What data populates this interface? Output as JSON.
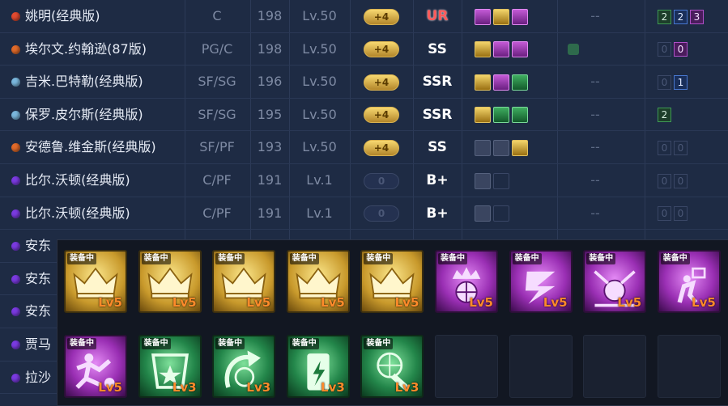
{
  "rows": [
    {
      "name": "姚明(经典版)",
      "dot": "#e04a30",
      "pos": "C",
      "height": "198",
      "level": "Lv.50",
      "plus": "+4",
      "plus_on": true,
      "rank": "UR",
      "skills": [
        "purple",
        "gold",
        "purple"
      ],
      "dash": "--",
      "badges": [
        {
          "t": "2",
          "c": "g"
        },
        {
          "t": "2",
          "c": "b"
        },
        {
          "t": "3",
          "c": "p"
        }
      ]
    },
    {
      "name": "埃尔文.约翰逊(87版)",
      "dot": "#e06a2a",
      "pos": "PG/C",
      "height": "198",
      "level": "Lv.50",
      "plus": "+4",
      "plus_on": true,
      "rank": "SS",
      "skills": [
        "gold",
        "purple",
        "purple"
      ],
      "extra": true,
      "dash": "",
      "badges": [
        {
          "t": "0",
          "c": ""
        },
        {
          "t": "0",
          "c": "p"
        }
      ]
    },
    {
      "name": "吉米.巴特勒(经典版)",
      "dot": "#7ab6dc",
      "pos": "SF/SG",
      "height": "196",
      "level": "Lv.50",
      "plus": "+4",
      "plus_on": true,
      "rank": "SSR",
      "skills": [
        "gold",
        "purple",
        "green"
      ],
      "dash": "--",
      "badges": [
        {
          "t": "0",
          "c": ""
        },
        {
          "t": "1",
          "c": "b"
        }
      ]
    },
    {
      "name": "保罗.皮尔斯(经典版)",
      "dot": "#7ab6dc",
      "pos": "SF/SG",
      "height": "195",
      "level": "Lv.50",
      "plus": "+4",
      "plus_on": true,
      "rank": "SSR",
      "skills": [
        "gold",
        "green",
        "green"
      ],
      "dash": "--",
      "badges": [
        {
          "t": "2",
          "c": "g"
        }
      ]
    },
    {
      "name": "安德鲁.维金斯(经典版)",
      "dot": "#e06a2a",
      "pos": "SF/PF",
      "height": "193",
      "level": "Lv.50",
      "plus": "+4",
      "plus_on": true,
      "rank": "SS",
      "skills": [
        "grey",
        "grey",
        "gold"
      ],
      "dash": "--",
      "badges": [
        {
          "t": "0",
          "c": ""
        },
        {
          "t": "0",
          "c": ""
        }
      ]
    },
    {
      "name": "比尔.沃顿(经典版)",
      "dot": "#7a3ae0",
      "pos": "C/PF",
      "height": "191",
      "level": "Lv.1",
      "plus": "0",
      "plus_on": false,
      "rank": "B+",
      "skills": [
        "lock",
        "empty"
      ],
      "dash": "--",
      "badges": [
        {
          "t": "0",
          "c": ""
        },
        {
          "t": "0",
          "c": ""
        }
      ]
    },
    {
      "name": "比尔.沃顿(经典版)",
      "dot": "#7a3ae0",
      "pos": "C/PF",
      "height": "191",
      "level": "Lv.1",
      "plus": "0",
      "plus_on": false,
      "rank": "B+",
      "skills": [
        "lock",
        "empty"
      ],
      "dash": "--",
      "badges": [
        {
          "t": "0",
          "c": ""
        },
        {
          "t": "0",
          "c": ""
        }
      ]
    },
    {
      "name": "安东",
      "dot": "#7a3ae0"
    },
    {
      "name": "安东",
      "dot": "#7a3ae0"
    },
    {
      "name": "安东",
      "dot": "#7a3ae0"
    },
    {
      "name": "贾马",
      "dot": "#7a3ae0"
    },
    {
      "name": "拉沙",
      "dot": "#7a3ae0"
    }
  ],
  "popup": {
    "equipped_tag": "装备中",
    "row1": [
      {
        "color": "gold",
        "glyph": "crown-icon",
        "level": "Lv5"
      },
      {
        "color": "gold",
        "glyph": "crown-icon",
        "level": "Lv5"
      },
      {
        "color": "gold",
        "glyph": "crown-icon",
        "level": "Lv5"
      },
      {
        "color": "gold",
        "glyph": "crown-icon",
        "level": "Lv5"
      },
      {
        "color": "gold",
        "glyph": "crown-icon",
        "level": "Lv5"
      },
      {
        "color": "purple",
        "glyph": "crown-ball-icon",
        "level": "Lv5"
      },
      {
        "color": "purple",
        "glyph": "play-arrow-icon",
        "level": "Lv5"
      },
      {
        "color": "purple",
        "glyph": "arrows-ball-icon",
        "level": "Lv5"
      },
      {
        "color": "purple",
        "glyph": "shooter-icon",
        "level": "Lv5"
      }
    ],
    "row2": [
      {
        "color": "purple",
        "glyph": "dunk-icon",
        "level": "Lv5"
      },
      {
        "color": "green",
        "glyph": "star-hoop-icon",
        "level": "Lv3"
      },
      {
        "color": "green",
        "glyph": "swing-arrow-icon",
        "level": "Lv3"
      },
      {
        "color": "green",
        "glyph": "energy-can-icon",
        "level": "Lv3"
      },
      {
        "color": "green",
        "glyph": "ball-net-icon",
        "level": "Lv3"
      },
      {
        "color": "empty"
      },
      {
        "color": "empty"
      },
      {
        "color": "empty"
      },
      {
        "color": "empty"
      }
    ]
  }
}
